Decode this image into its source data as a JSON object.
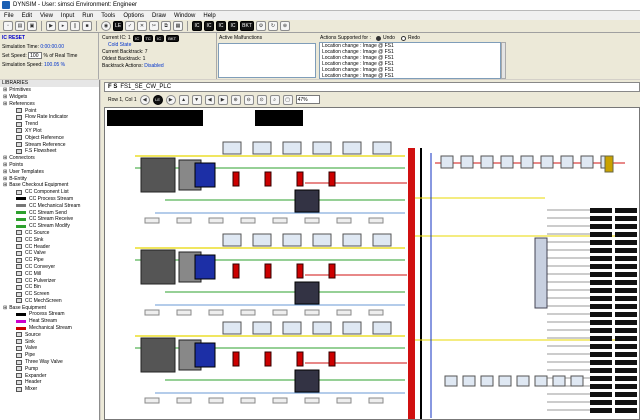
{
  "app": {
    "title": "DYNSIM - User: simsci   Environment: Engineer"
  },
  "menu": [
    "File",
    "Edit",
    "View",
    "Input",
    "Run",
    "Tools",
    "Options",
    "Draw",
    "Window",
    "Help"
  ],
  "toolbar": {
    "buttons": [
      "LE",
      "IC",
      "IC",
      "IC",
      "IC",
      "BKT"
    ]
  },
  "sim": {
    "ic_reset": "IC RESET",
    "time_label": "Simulation Time:",
    "time_value": "0:00:00.00",
    "speed_label": "Set Speed:",
    "speed_value": "100",
    "speed_unit": "% of Real Time",
    "sim_speed_label": "Simulation Speed:",
    "sim_speed_value": "100.05 %"
  },
  "ic_panel": {
    "current_ic": "Current IC: 1",
    "state": "Cold State",
    "current_backtrack": "Current Backtrack: 7",
    "oldest_backtrack": "Oldest Backtrack: 1",
    "backtrack_actions_label": "Backtrack Actions:",
    "backtrack_actions_value": "Disabled",
    "buttons": [
      "IC",
      "TC",
      "IC",
      "BKT"
    ]
  },
  "malfunctions": {
    "title": "Active Malfunctions"
  },
  "actions": {
    "label": "Actions Supported for :",
    "undo": "Undo",
    "redo": "Redo",
    "items": [
      "Location change : Image @ FS1",
      "Location change : Image @ FS1",
      "Location change : Image @ FS1",
      "Location change : Image @ FS1",
      "Location change : Image @ FS1",
      "Location change : Image @ FS1"
    ]
  },
  "library": {
    "title": "LIBRARIES",
    "items": [
      {
        "t": "Primitives",
        "lvl": 1
      },
      {
        "t": "Widgets",
        "lvl": 1
      },
      {
        "t": "References",
        "lvl": 1
      },
      {
        "t": "Point",
        "lvl": 2
      },
      {
        "t": "Flow Rate Indicator",
        "lvl": 2
      },
      {
        "t": "Trend",
        "lvl": 2
      },
      {
        "t": "XY Plot",
        "lvl": 2
      },
      {
        "t": "Object Reference",
        "lvl": 2
      },
      {
        "t": "Stream Reference",
        "lvl": 2
      },
      {
        "t": "F.S  Flowsheet",
        "lvl": 2
      },
      {
        "t": "Connectors",
        "lvl": 1
      },
      {
        "t": "Points",
        "lvl": 1
      },
      {
        "t": "User Templates",
        "lvl": 1
      },
      {
        "t": "B-Entity",
        "lvl": 1
      },
      {
        "t": "Base Checkout Equipment",
        "lvl": 1
      },
      {
        "t": "CC Component List",
        "lvl": 2
      },
      {
        "t": "CC Process Stream",
        "lvl": 2
      },
      {
        "t": "CC Mechanical Stream",
        "lvl": 2
      },
      {
        "t": "CC Stream Send",
        "lvl": 2
      },
      {
        "t": "CC Stream Receive",
        "lvl": 2
      },
      {
        "t": "CC Stream Modify",
        "lvl": 2
      },
      {
        "t": "CC Source",
        "lvl": 2
      },
      {
        "t": "CC Sink",
        "lvl": 2
      },
      {
        "t": "CC Header",
        "lvl": 2
      },
      {
        "t": "CC Valve",
        "lvl": 2
      },
      {
        "t": "CC Pipe",
        "lvl": 2
      },
      {
        "t": "CC Conveyer",
        "lvl": 2
      },
      {
        "t": "CC Mill",
        "lvl": 2
      },
      {
        "t": "CC Pulverizer",
        "lvl": 2
      },
      {
        "t": "CC Bin",
        "lvl": 2
      },
      {
        "t": "CC Screen",
        "lvl": 2
      },
      {
        "t": "CC MechScreen",
        "lvl": 2
      },
      {
        "t": "Base Equipment",
        "lvl": 1
      },
      {
        "t": "Process Stream",
        "lvl": 2
      },
      {
        "t": "Heat Stream",
        "lvl": 2
      },
      {
        "t": "Mechanical Stream",
        "lvl": 2
      },
      {
        "t": "Source",
        "lvl": 2
      },
      {
        "t": "Sink",
        "lvl": 2
      },
      {
        "t": "Valve",
        "lvl": 2
      },
      {
        "t": "Pipe",
        "lvl": 2
      },
      {
        "t": "Three Way Valve",
        "lvl": 2
      },
      {
        "t": "Pump",
        "lvl": 2
      },
      {
        "t": "Expander",
        "lvl": 2
      },
      {
        "t": "Header",
        "lvl": 2
      },
      {
        "t": "Mixer",
        "lvl": 2
      }
    ]
  },
  "document": {
    "title": "FS1_SE_CW_PLC",
    "position": "Row 1, Col 1",
    "zoom": "47%"
  },
  "colors": {
    "accent": "#1a5fb4",
    "pipe_green": "#2ea02e",
    "pipe_yellow": "#e8d800",
    "pipe_red": "#d01010",
    "pipe_blue": "#1030c0"
  }
}
